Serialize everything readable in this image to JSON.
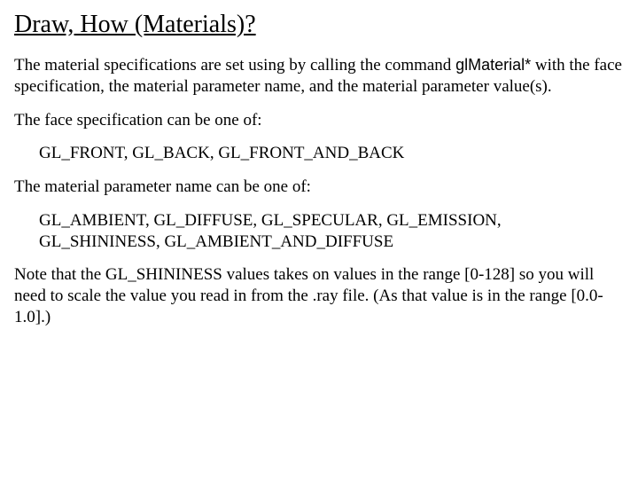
{
  "title": "Draw, How (Materials)?",
  "p1_a": "The material specifications are set using by calling the command ",
  "p1_b": "glMaterial*",
  "p1_c": " with the face specification, the material parameter name, and the material parameter value(s).",
  "p2": "The face specification can be one of:",
  "faces": "GL_FRONT, GL_BACK, GL_FRONT_AND_BACK",
  "p3": "The material parameter name can be one of:",
  "params": "GL_AMBIENT, GL_DIFFUSE, GL_SPECULAR, GL_EMISSION, GL_SHININESS, GL_AMBIENT_AND_DIFFUSE",
  "p4": "Note that the GL_SHININESS values takes on values in the range [0-128] so you will need to scale the value you read in from the .ray file. (As that value is in the range [0.0-1.0].)"
}
